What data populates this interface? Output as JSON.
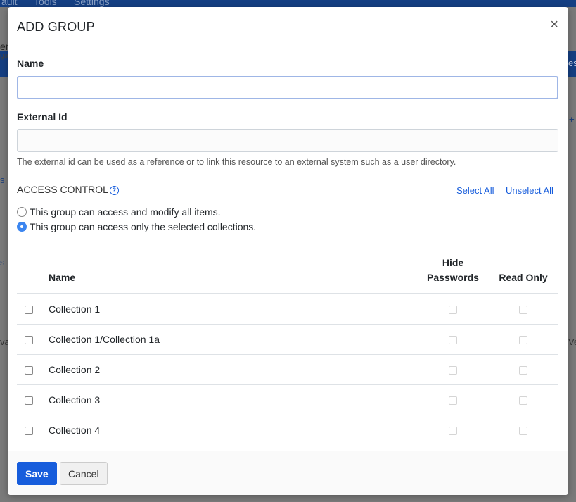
{
  "background": {
    "nav": [
      "ault",
      "Tools",
      "Settings"
    ],
    "fragments": [
      "en",
      "ga",
      "es",
      "s",
      "s",
      "va",
      "Ve",
      "+"
    ]
  },
  "modal": {
    "title": "ADD GROUP",
    "close_glyph": "×",
    "name_label": "Name",
    "name_value": "",
    "external_id_label": "External Id",
    "external_id_value": "",
    "external_id_help": "The external id can be used as a reference or to link this resource to an external system such as a user directory.",
    "access_control": {
      "title": "ACCESS CONTROL",
      "help_glyph": "?",
      "select_all": "Select All",
      "unselect_all": "Unselect All",
      "options": [
        {
          "label": "This group can access and modify all items.",
          "selected": false
        },
        {
          "label": "This group can access only the selected collections.",
          "selected": true
        }
      ]
    },
    "table": {
      "headers": {
        "name": "Name",
        "hide_passwords_1": "Hide",
        "hide_passwords_2": "Passwords",
        "read_only": "Read Only"
      },
      "rows": [
        {
          "name": "Collection 1"
        },
        {
          "name": "Collection 1/Collection 1a"
        },
        {
          "name": "Collection 2"
        },
        {
          "name": "Collection 3"
        },
        {
          "name": "Collection 4"
        }
      ]
    },
    "footer": {
      "save": "Save",
      "cancel": "Cancel"
    }
  },
  "colors": {
    "accent": "#175ddc",
    "radio_selected": "#3c86f0",
    "nav_bg": "#153f83"
  }
}
